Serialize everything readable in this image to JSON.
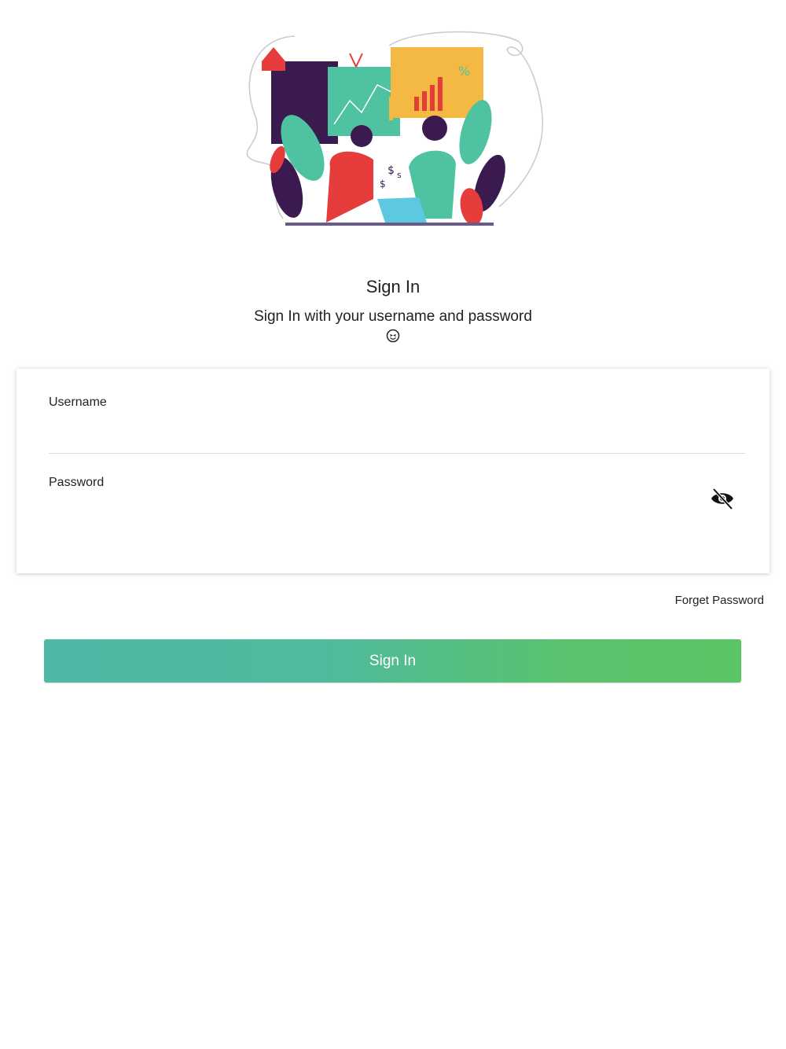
{
  "header": {
    "title": "Sign In",
    "subtitle": "Sign In with your username and password"
  },
  "form": {
    "username_label": "Username",
    "username_value": "",
    "password_label": "Password",
    "password_value": "",
    "password_toggle_icon": "eye-off-icon"
  },
  "links": {
    "forget_password": "Forget Password"
  },
  "actions": {
    "sign_in_label": "Sign In"
  },
  "icons": {
    "smiley": "smiley-icon",
    "illustration": "team-analytics-illustration"
  },
  "colors": {
    "button_gradient_start": "#4db8a4",
    "button_gradient_end": "#5bc466",
    "illustration_red": "#e63c3c",
    "illustration_teal": "#4fc3a1",
    "illustration_purple": "#3b1b4f",
    "illustration_yellow": "#f4b942"
  }
}
